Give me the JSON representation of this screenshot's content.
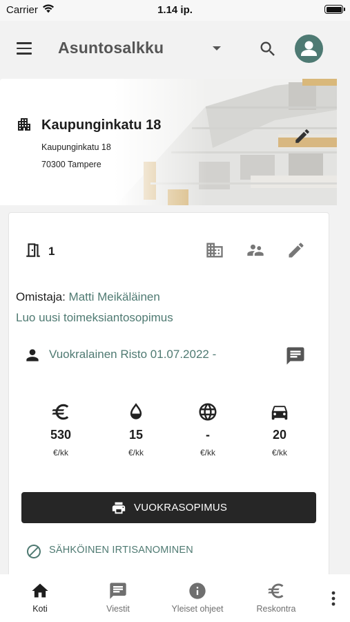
{
  "status_bar": {
    "carrier": "Carrier",
    "time": "1.14 ip."
  },
  "app_bar": {
    "title": "Asuntosalkku"
  },
  "building": {
    "name": "Kaupunginkatu 18",
    "street": "Kaupunginkatu 18",
    "city": "70300 Tampere"
  },
  "apartment": {
    "number": "1",
    "owner_label": "Omistaja:",
    "owner_name": "Matti Meikäläinen",
    "new_contract_link": "Luo uusi toimeksiantosopimus",
    "tenant": "Vuokralainen Risto 01.07.2022 -",
    "costs": [
      {
        "icon": "euro-icon",
        "value": "530",
        "unit": "€/kk"
      },
      {
        "icon": "water-drop-icon",
        "value": "15",
        "unit": "€/kk"
      },
      {
        "icon": "globe-icon",
        "value": "-",
        "unit": "€/kk"
      },
      {
        "icon": "car-icon",
        "value": "20",
        "unit": "€/kk"
      }
    ],
    "print_button": "VUOKRASOPIMUS",
    "termination_link": "SÄHKÖINEN IRTISANOMINEN"
  },
  "bottom_nav": {
    "items": [
      {
        "label": "Koti",
        "icon": "home-icon",
        "active": true
      },
      {
        "label": "Viestit",
        "icon": "chat-icon",
        "active": false
      },
      {
        "label": "Yleiset ohjeet",
        "icon": "info-icon",
        "active": false
      },
      {
        "label": "Reskontra",
        "icon": "euro-icon",
        "active": false
      }
    ],
    "more_icon": "more-vert-icon"
  },
  "colors": {
    "accent": "#4f7a72",
    "avatar_bg": "#4e7a73",
    "button_bg": "#262626",
    "active_nav": "#1e1e1e",
    "inactive_nav": "#6f6f6f"
  }
}
